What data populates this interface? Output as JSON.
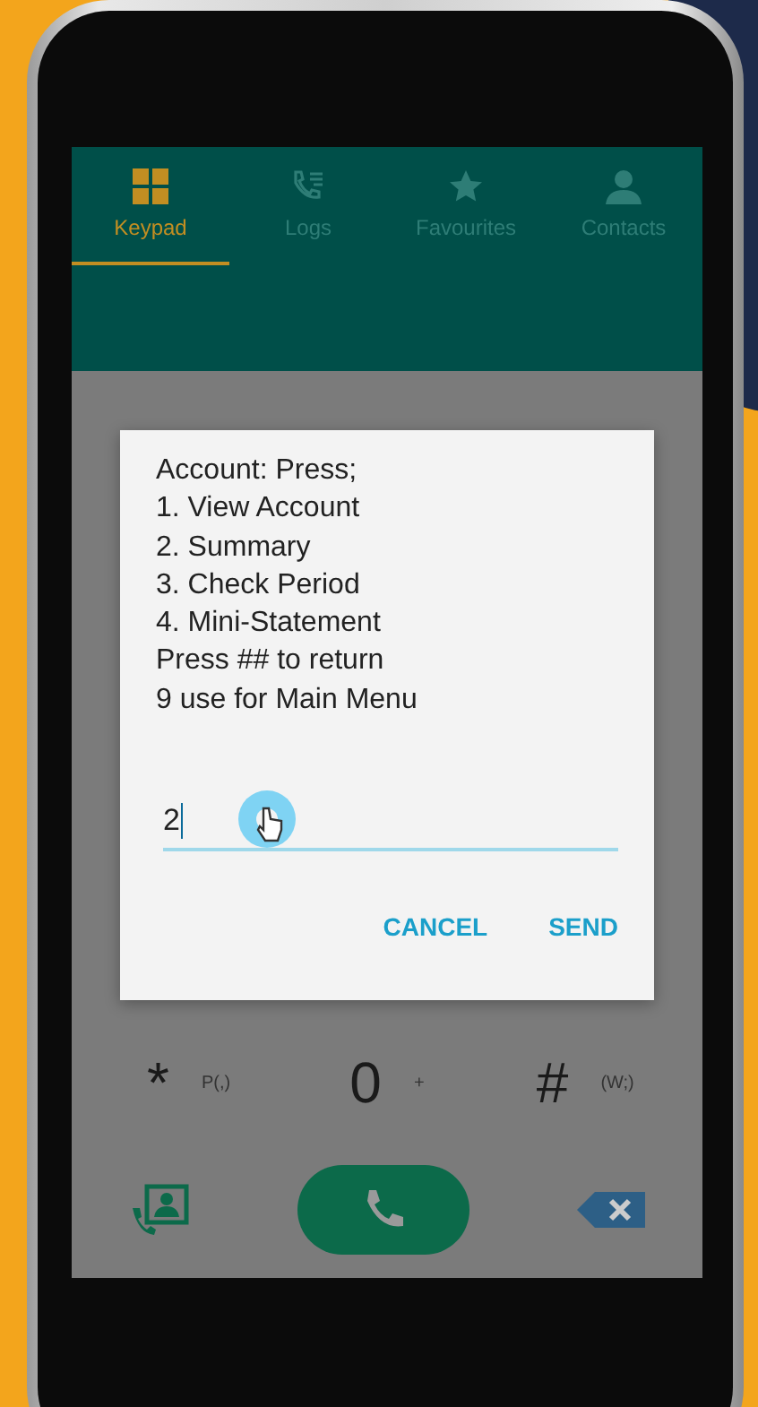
{
  "tabs": [
    {
      "label": "Keypad",
      "selected": true
    },
    {
      "label": "Logs",
      "selected": false
    },
    {
      "label": "Favourites",
      "selected": false
    },
    {
      "label": "Contacts",
      "selected": false
    }
  ],
  "dialog": {
    "lines": [
      "Account: Press;",
      "1. View Account",
      "2. Summary",
      "3. Check Period",
      "4. Mini-Statement",
      "Press ## to return",
      "9 use for Main Menu"
    ],
    "input": {
      "value": "2"
    },
    "buttons": [
      "CANCEL",
      "SEND"
    ]
  },
  "keypad_row": [
    {
      "key": "*",
      "sub": "P(,)"
    },
    {
      "key": "0",
      "sub": "+"
    },
    {
      "key": "#",
      "sub": "(W;)"
    }
  ]
}
